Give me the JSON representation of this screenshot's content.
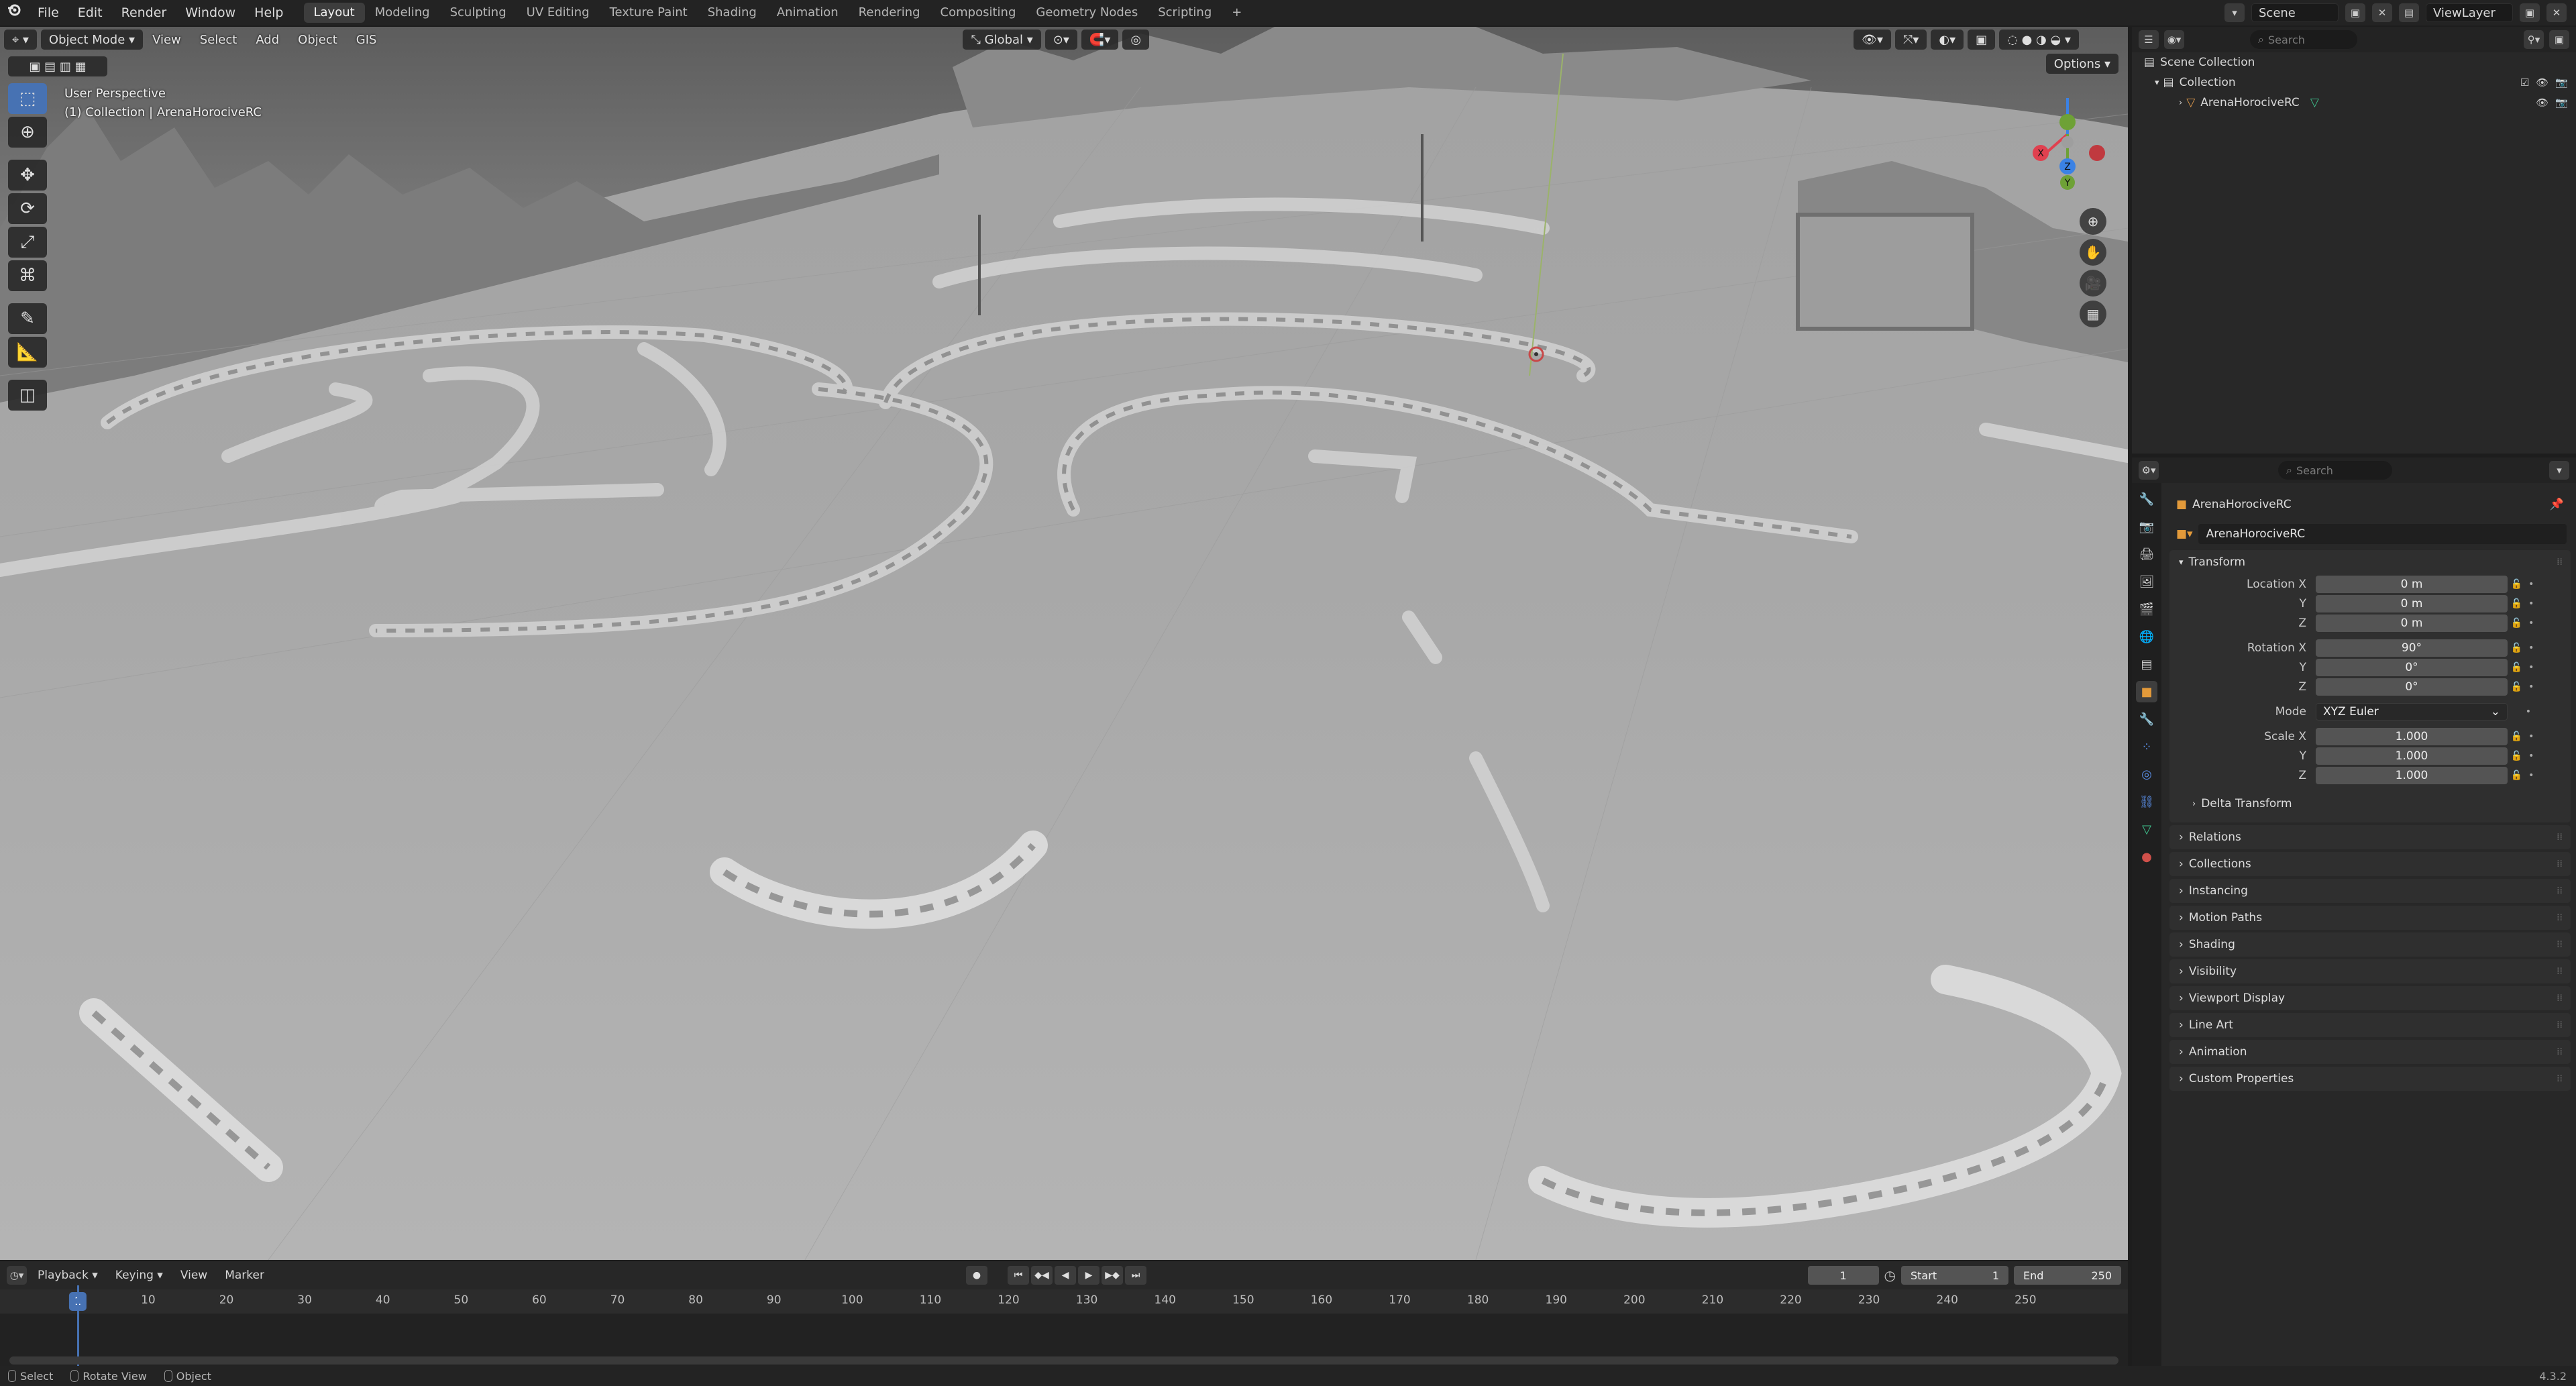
{
  "menu": {
    "items": [
      "File",
      "Edit",
      "Render",
      "Window",
      "Help"
    ]
  },
  "workspaces": [
    "Layout",
    "Modeling",
    "Sculpting",
    "UV Editing",
    "Texture Paint",
    "Shading",
    "Animation",
    "Rendering",
    "Compositing",
    "Geometry Nodes",
    "Scripting"
  ],
  "active_workspace": "Layout",
  "top_right": {
    "scene": "Scene",
    "view_layer": "ViewLayer"
  },
  "viewport": {
    "mode": "Object Mode",
    "menus": [
      "View",
      "Select",
      "Add",
      "Object",
      "GIS"
    ],
    "orientation": "Global",
    "options": "Options",
    "perspective": "User Perspective",
    "collection_info": "(1) Collection | ArenaHorociveRC"
  },
  "toolbar": {
    "tools": [
      "select-box",
      "cursor",
      "move",
      "rotate",
      "scale",
      "transform",
      "annotate",
      "measure",
      "add-cube"
    ]
  },
  "outliner": {
    "search_placeholder": "Search",
    "scene_collection": "Scene Collection",
    "collection": "Collection",
    "object": "ArenaHorociveRC"
  },
  "properties": {
    "search_placeholder": "Search",
    "object_name": "ArenaHorociveRC",
    "object_field": "ArenaHorociveRC",
    "transform_title": "Transform",
    "location": {
      "label": "Location X",
      "y_label": "Y",
      "z_label": "Z",
      "x": "0 m",
      "y": "0 m",
      "z": "0 m"
    },
    "rotation": {
      "label": "Rotation X",
      "y_label": "Y",
      "z_label": "Z",
      "x": "90°",
      "y": "0°",
      "z": "0°"
    },
    "mode": {
      "label": "Mode",
      "value": "XYZ Euler"
    },
    "scale": {
      "label": "Scale X",
      "y_label": "Y",
      "z_label": "Z",
      "x": "1.000",
      "y": "1.000",
      "z": "1.000"
    },
    "delta_transform": "Delta Transform",
    "sections": [
      "Relations",
      "Collections",
      "Instancing",
      "Motion Paths",
      "Shading",
      "Visibility",
      "Viewport Display",
      "Line Art",
      "Animation",
      "Custom Properties"
    ]
  },
  "timeline": {
    "menus": [
      "Playback",
      "Keying",
      "View",
      "Marker"
    ],
    "current_frame": "1",
    "start_label": "Start",
    "start": "1",
    "end_label": "End",
    "end": "250",
    "ticks": [
      "10",
      "20",
      "30",
      "40",
      "50",
      "60",
      "70",
      "80",
      "90",
      "100",
      "110",
      "120",
      "130",
      "140",
      "150",
      "160",
      "170",
      "180",
      "190",
      "200",
      "210",
      "220",
      "230",
      "240",
      "250"
    ]
  },
  "status": {
    "select": "Select",
    "rotate": "Rotate View",
    "object": "Object",
    "version": "4.3.2"
  },
  "colors": {
    "accent": "#4772b3",
    "x_axis": "#e0404f",
    "y_axis": "#6ea136",
    "z_axis": "#3b82e5"
  }
}
